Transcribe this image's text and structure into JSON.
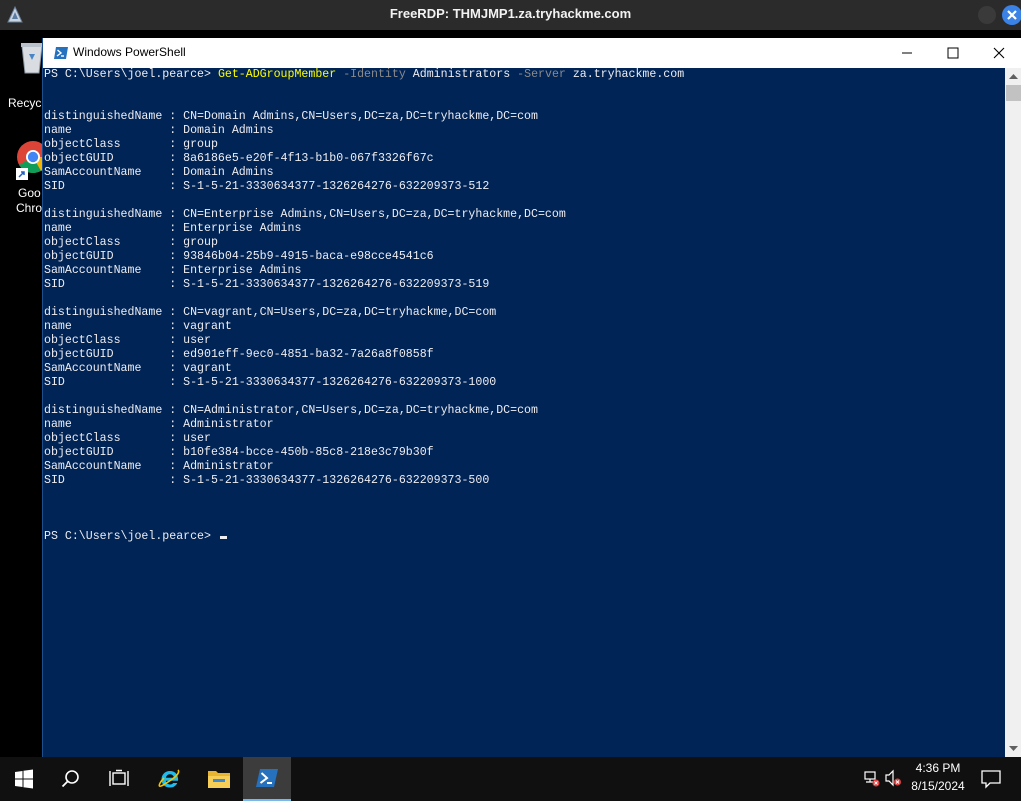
{
  "rdp": {
    "title": "FreeRDP: THMJMP1.za.tryhackme.com"
  },
  "desktop": {
    "recycle_label": "Recycl",
    "chrome_label_1": "Goo",
    "chrome_label_2": "Chro"
  },
  "window": {
    "title": "Windows PowerShell"
  },
  "console": {
    "prompt": "PS C:\\Users\\joel.pearce> ",
    "command": "Get-ADGroupMember",
    "param1": "-Identity",
    "arg1": "Administrators",
    "param2": "-Server",
    "arg2": "za.tryhackme.com",
    "entries": [
      [
        "distinguishedName : CN=Domain Admins,CN=Users,DC=za,DC=tryhackme,DC=com",
        "name              : Domain Admins",
        "objectClass       : group",
        "objectGUID        : 8a6186e5-e20f-4f13-b1b0-067f3326f67c",
        "SamAccountName    : Domain Admins",
        "SID               : S-1-5-21-3330634377-1326264276-632209373-512"
      ],
      [
        "distinguishedName : CN=Enterprise Admins,CN=Users,DC=za,DC=tryhackme,DC=com",
        "name              : Enterprise Admins",
        "objectClass       : group",
        "objectGUID        : 93846b04-25b9-4915-baca-e98cce4541c6",
        "SamAccountName    : Enterprise Admins",
        "SID               : S-1-5-21-3330634377-1326264276-632209373-519"
      ],
      [
        "distinguishedName : CN=vagrant,CN=Users,DC=za,DC=tryhackme,DC=com",
        "name              : vagrant",
        "objectClass       : user",
        "objectGUID        : ed901eff-9ec0-4851-ba32-7a26a8f0858f",
        "SamAccountName    : vagrant",
        "SID               : S-1-5-21-3330634377-1326264276-632209373-1000"
      ],
      [
        "distinguishedName : CN=Administrator,CN=Users,DC=za,DC=tryhackme,DC=com",
        "name              : Administrator",
        "objectClass       : user",
        "objectGUID        : b10fe384-bcce-450b-85c8-218e3c79b30f",
        "SamAccountName    : Administrator",
        "SID               : S-1-5-21-3330634377-1326264276-632209373-500"
      ]
    ],
    "final_prompt": "PS C:\\Users\\joel.pearce> "
  },
  "taskbar": {
    "time": "4:36 PM",
    "date": "8/15/2024"
  },
  "colors": {
    "console_bg": "#012456",
    "console_fg": "#eeedf0",
    "command": "#ffff00",
    "parameter": "#8a8a8a",
    "rdp_close": "#3b82e6"
  },
  "icons": {
    "rdp_logo": "freerdp-logo-icon",
    "ps_title": "powershell-icon",
    "start": "windows-logo-icon",
    "search": "search-icon",
    "task_view": "task-view-icon",
    "ie": "internet-explorer-icon",
    "explorer": "folder-icon",
    "powershell": "powershell-icon",
    "network": "network-icon",
    "volume": "volume-muted-icon",
    "notifications": "action-center-icon"
  }
}
